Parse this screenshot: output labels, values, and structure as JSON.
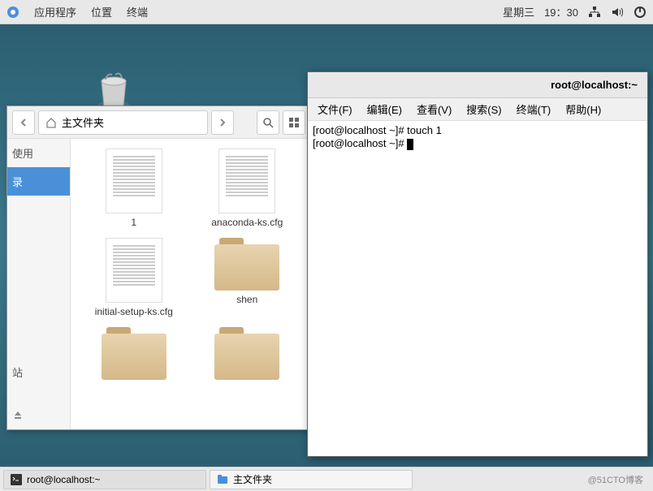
{
  "top_panel": {
    "apps": "应用程序",
    "places": "位置",
    "terminal": "终端",
    "date": "星期三",
    "time": "19：30"
  },
  "file_manager": {
    "location": "主文件夹",
    "sidebar": {
      "recent": "使用",
      "home": "录",
      "other": "站"
    },
    "items": [
      {
        "name": "1",
        "type": "file"
      },
      {
        "name": "anaconda-ks.cfg",
        "type": "file"
      },
      {
        "name": "initial-setup-ks.cfg",
        "type": "file"
      },
      {
        "name": "shen",
        "type": "folder"
      },
      {
        "name": "",
        "type": "folder"
      },
      {
        "name": "",
        "type": "folder"
      }
    ]
  },
  "terminal": {
    "title": "root@localhost:~",
    "menu": {
      "file": "文件(F)",
      "edit": "编辑(E)",
      "view": "查看(V)",
      "search": "搜索(S)",
      "terminal": "终端(T)",
      "help": "帮助(H)"
    },
    "lines": [
      "[root@localhost ~]# touch 1",
      "[root@localhost ~]# "
    ]
  },
  "taskbar": {
    "task1": "root@localhost:~",
    "task2": "主文件夹",
    "watermark": "@51CTO博客"
  }
}
